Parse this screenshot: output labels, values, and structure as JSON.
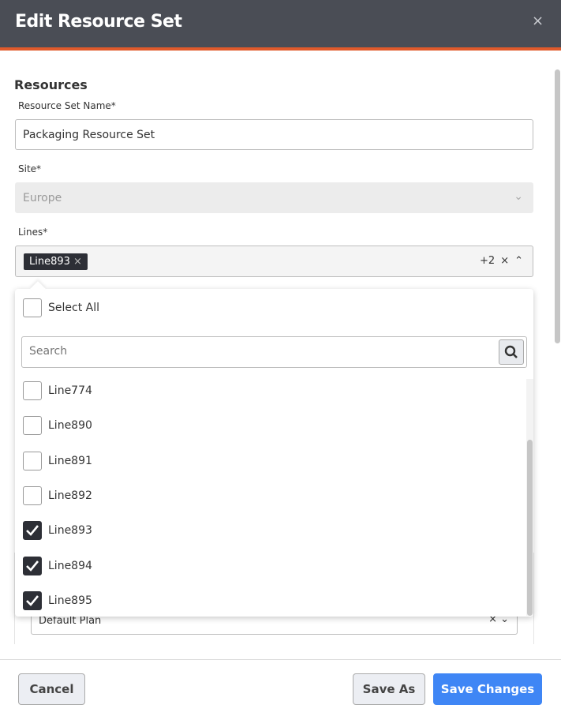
{
  "dialog": {
    "title": "Edit Resource Set",
    "close": "×"
  },
  "section": "Resources",
  "name_field": {
    "label": "Resource Set Name*",
    "value": "Packaging Resource Set"
  },
  "site_field": {
    "label": "Site*",
    "value": "Europe"
  },
  "lines_field": {
    "label": "Lines*",
    "chip": "Line893",
    "more": "+2"
  },
  "dropdown": {
    "select_all": "Select All",
    "search_placeholder": "Search",
    "items": [
      {
        "label": "Line774",
        "checked": false
      },
      {
        "label": "Line890",
        "checked": false
      },
      {
        "label": "Line891",
        "checked": false
      },
      {
        "label": "Line892",
        "checked": false
      },
      {
        "label": "Line893",
        "checked": true
      },
      {
        "label": "Line894",
        "checked": true
      },
      {
        "label": "Line895",
        "checked": true
      }
    ]
  },
  "plan_field": {
    "value": "Default Plan"
  },
  "footer": {
    "cancel": "Cancel",
    "save_as": "Save As",
    "save_changes": "Save Changes"
  },
  "colors": {
    "header": "#4a4d55",
    "accent": "#e05a2b",
    "primary": "#3f86f5"
  }
}
